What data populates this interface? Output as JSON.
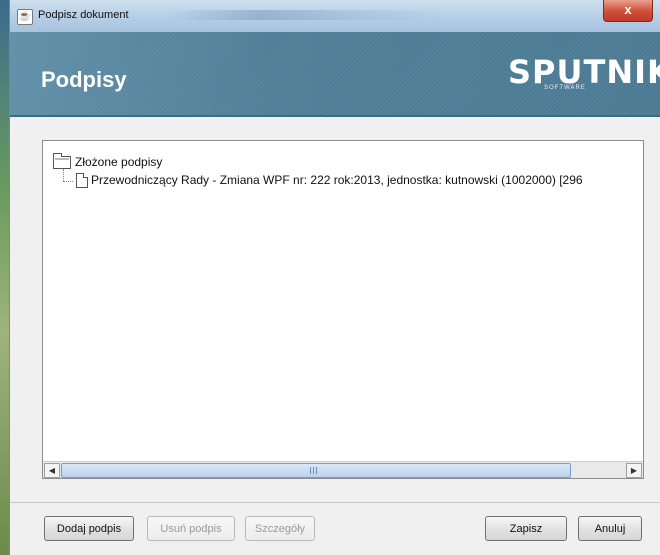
{
  "window": {
    "title": "Podpisz dokument",
    "close_label": "x"
  },
  "header": {
    "title": "Podpisy",
    "logo_main": "SPUTNIK",
    "logo_sub": "SOFTWARE"
  },
  "tree": {
    "root_label": "Złożone podpisy",
    "children": [
      {
        "label": "Przewodniczący Rady - Zmiana WPF nr: 222 rok:2013, jednostka: kutnowski (1002000) [296"
      }
    ]
  },
  "scrollbar": {
    "left_arrow": "◀",
    "right_arrow": "▶"
  },
  "buttons": {
    "add": "Dodaj podpis",
    "remove": "Usuń podpis",
    "details": "Szczegóły",
    "save": "Zapisz",
    "cancel": "Anuluj"
  },
  "colors": {
    "header_bg": "#4e7e98",
    "close_red": "#c0392b"
  }
}
